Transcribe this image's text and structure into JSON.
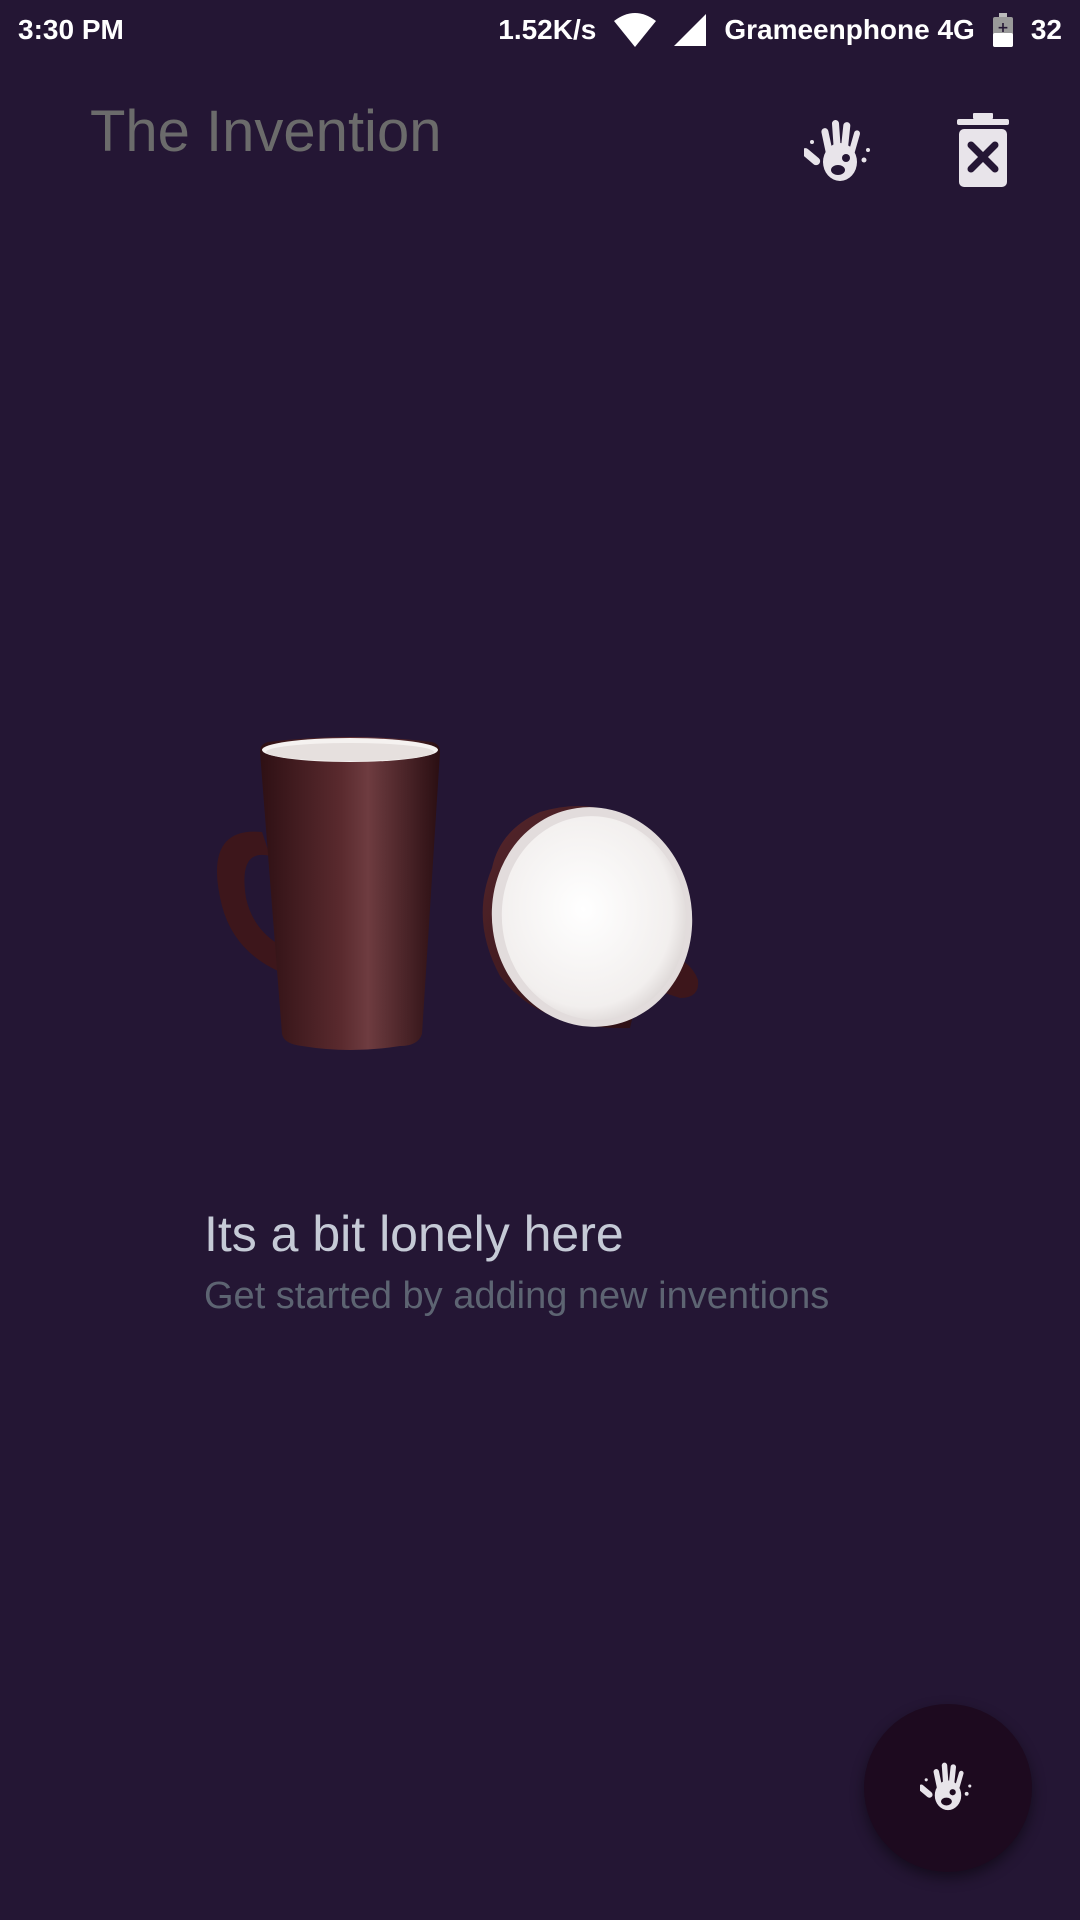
{
  "status_bar": {
    "time": "3:30 PM",
    "speed": "1.52K/s",
    "carrier": "Grameenphone 4G",
    "battery": "32",
    "icons": [
      "wifi-icon",
      "signal-icon",
      "battery-icon"
    ]
  },
  "app_bar": {
    "title": "The Invention",
    "actions": [
      "hand-icon",
      "trash-icon"
    ]
  },
  "empty_state": {
    "illustration": "mugs-illustration",
    "title": "Its a bit lonely here",
    "subtitle": "Get started by adding new inventions"
  },
  "fab": {
    "icon": "hand-icon"
  },
  "colors": {
    "background": "#241634",
    "title": "#6b6b6b",
    "empty_title": "#c5cad6",
    "empty_subtitle": "#5d6472",
    "fab": "#1d0a1f",
    "mug": "#4a1e22"
  }
}
